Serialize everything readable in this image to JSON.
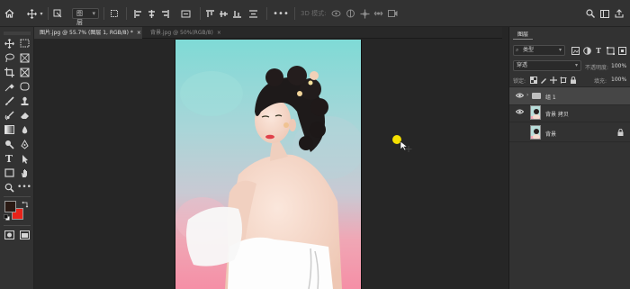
{
  "options_bar": {
    "icons": [
      "home-icon",
      "move-icon",
      "auto-select-icon",
      "transform-icon",
      "align-left-icon",
      "align-hcenter-icon",
      "align-right-icon",
      "distribute-icon",
      "align-top-icon",
      "align-vcenter-icon",
      "align-bottom-icon",
      "distribute-v-icon",
      "more-icon",
      "orbit-icon",
      "roll-icon",
      "pan-icon",
      "slide-icon",
      "video-icon",
      "search-icon",
      "workspace-icon",
      "share-icon"
    ],
    "target_dropdown": "图层",
    "mode_3d_label": "3D 模式:"
  },
  "document_tabs": [
    {
      "label": "图片.jpg @ 55.7% (图层 1, RGB/8) *",
      "active": true
    },
    {
      "label": "背景.jpg @ 50%(RGB/8)",
      "active": false
    }
  ],
  "tab_close": "×",
  "layers_panel": {
    "tab": "图层",
    "filter_label": "类型",
    "blend_mode": "穿透",
    "opacity_label": "不透明度:",
    "opacity_value": "100%",
    "lock_label": "锁定:",
    "fill_label": "填充:",
    "fill_value": "100%",
    "layers": [
      {
        "name": "组 1",
        "type": "group",
        "visible": true,
        "selected": true
      },
      {
        "name": "背景 拷贝",
        "type": "image",
        "visible": true,
        "selected": false
      },
      {
        "name": "背景",
        "type": "image",
        "visible": false,
        "selected": false,
        "locked": true
      }
    ]
  },
  "colors": {
    "foreground": "#2a1a14",
    "background": "#e8231a",
    "cursor_highlight": "#f5e000"
  }
}
